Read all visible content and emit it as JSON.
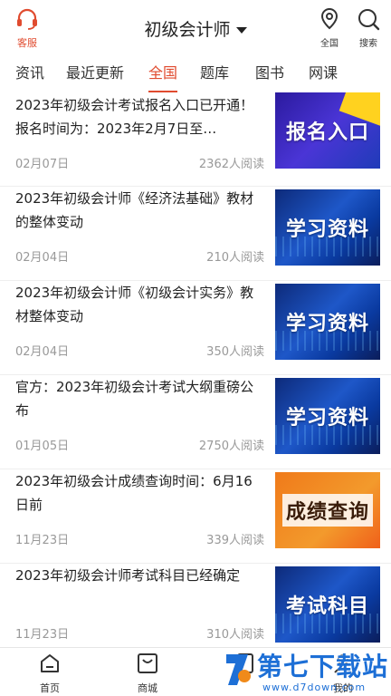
{
  "header": {
    "service_label": "客服",
    "title": "初级会计师",
    "region_label": "全国",
    "search_label": "搜索",
    "accent": "#e04b2f"
  },
  "tabs": [
    {
      "label": "资讯"
    },
    {
      "label": "最近更新"
    },
    {
      "label": "全国",
      "active": true
    },
    {
      "label": "题库"
    },
    {
      "label": "图书"
    },
    {
      "label": "网课"
    }
  ],
  "articles": [
    {
      "title": "2023年初级会计考试报名入口已开通！报名时间为：2023年2月7日至…",
      "date": "02月07日",
      "reads": "2362人阅读",
      "thumb_text": "报名入口",
      "thumb_style": "purple"
    },
    {
      "title": "2023年初级会计师《经济法基础》教材的整体变动",
      "date": "02月04日",
      "reads": "210人阅读",
      "thumb_text": "学习资料",
      "thumb_style": "blue"
    },
    {
      "title": "2023年初级会计师《初级会计实务》教材整体变动",
      "date": "02月04日",
      "reads": "350人阅读",
      "thumb_text": "学习资料",
      "thumb_style": "blue"
    },
    {
      "title": "官方：2023年初级会计考试大纲重磅公布",
      "date": "01月05日",
      "reads": "2750人阅读",
      "thumb_text": "学习资料",
      "thumb_style": "blue"
    },
    {
      "title": "2023年初级会计成绩查询时间：6月16日前",
      "date": "11月23日",
      "reads": "339人阅读",
      "thumb_text": "成绩查询",
      "thumb_style": "orange"
    },
    {
      "title": "2023年初级会计师考试科目已经确定",
      "date": "11月23日",
      "reads": "310人阅读",
      "thumb_text": "考试科目",
      "thumb_style": "blue"
    }
  ],
  "bottom_nav": [
    {
      "label": "首页",
      "icon": "home-icon"
    },
    {
      "label": "商城",
      "icon": "shop-icon"
    },
    {
      "label": "",
      "icon": "study-icon"
    },
    {
      "label": "我的",
      "icon": "profile-icon"
    }
  ],
  "watermark": {
    "brand": "第七下载站",
    "url": "www.d7down.com"
  }
}
